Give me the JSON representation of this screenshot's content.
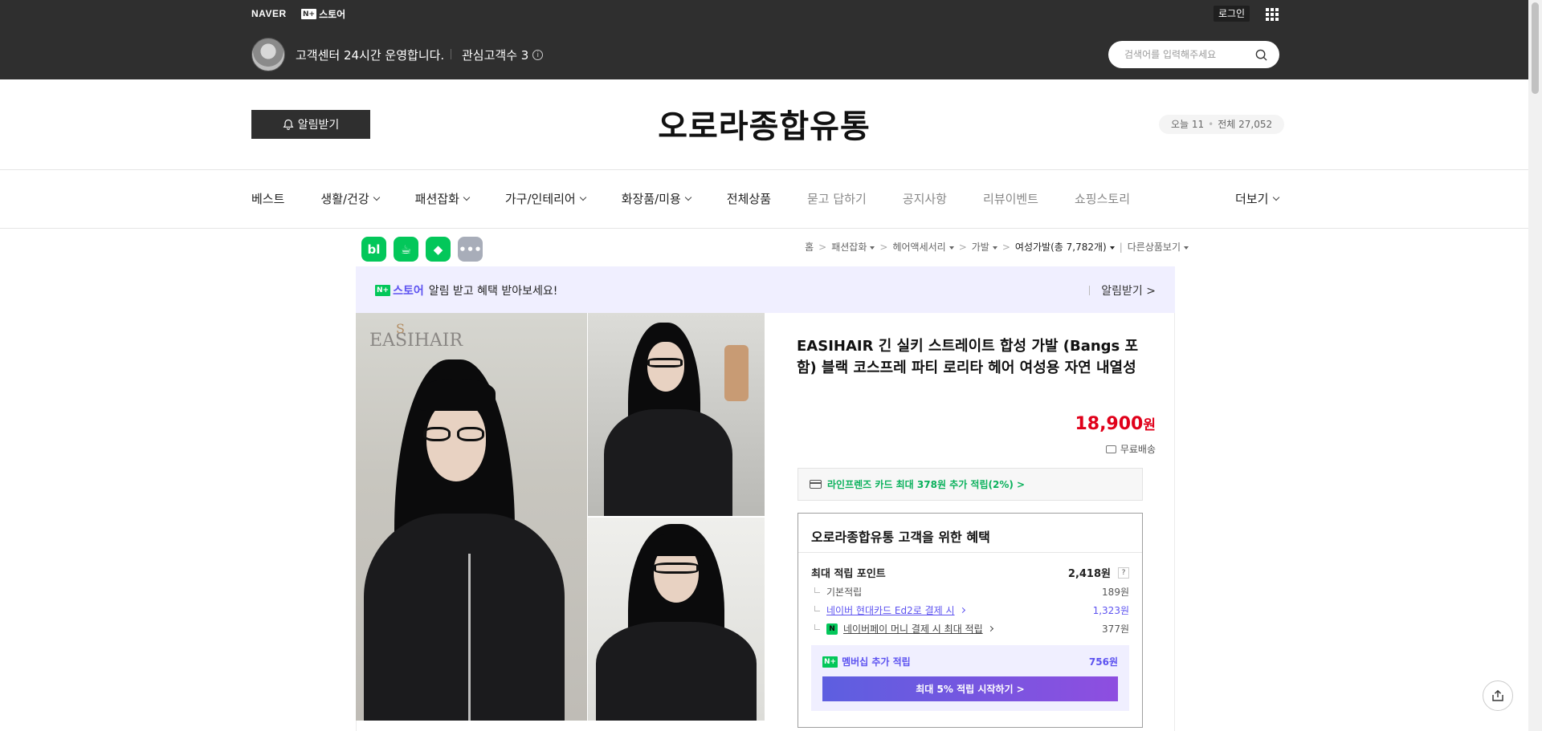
{
  "topbar": {
    "naver_logo": "NAVER",
    "nplus_box": "N+",
    "nplus_text": "스토어",
    "login": "로그인",
    "cs_text": "고객센터 24시간 운영합니다.",
    "fav_text": "관심고객수 3",
    "search_placeholder": "검색어를 입력해주세요"
  },
  "header": {
    "notify_label": "알림받기",
    "store_title": "오로라종합유통",
    "visit_today": "오늘 11",
    "visit_dot": "•",
    "visit_total": "전체 27,052"
  },
  "nav": {
    "items": [
      {
        "label": "베스트",
        "dropdown": false
      },
      {
        "label": "생활/건강",
        "dropdown": true
      },
      {
        "label": "패션잡화",
        "dropdown": true
      },
      {
        "label": "가구/인테리어",
        "dropdown": true
      },
      {
        "label": "화장품/미용",
        "dropdown": true
      },
      {
        "label": "전체상품",
        "dropdown": false
      },
      {
        "label": "묻고 답하기",
        "dropdown": false
      },
      {
        "label": "공지사항",
        "dropdown": false
      },
      {
        "label": "리뷰이벤트",
        "dropdown": false
      },
      {
        "label": "쇼핑스토리",
        "dropdown": false
      }
    ],
    "more": "더보기"
  },
  "social": {
    "blog_icon": "bl",
    "cafe_icon": "☕",
    "bookmark_icon": "◆",
    "more_icon": "•••"
  },
  "breadcrumb": {
    "home": "홈",
    "sep": ">",
    "cat1": "패션잡화",
    "cat2": "헤어액세서리",
    "cat3": "가발",
    "current": "여성가발(총 7,782개)",
    "other": "다른상품보기"
  },
  "promo": {
    "nbox": "N+",
    "store": "스토어",
    "text": "알림 받고 혜택 받아보세요!",
    "action": "알림받기 >"
  },
  "product": {
    "image_brand": "EASIHAIR",
    "title": "EASIHAIR 긴 실키 스트레이트 합성 가발 (Bangs 포함) 블랙 코스프레 파티 로리타 헤어 여성용 자연 내열성",
    "price": "18,900",
    "price_unit": "원",
    "shipping": "무료배송",
    "card_promo": "라인프렌즈 카드 최대 378원 추가 적립(2%) >"
  },
  "benefit": {
    "heading": "오로라종합유통 고객을 위한 혜택",
    "max_points_label": "최대 적립 포인트",
    "max_points_value": "2,418원",
    "qmark": "?",
    "basic_label": "기본적립",
    "basic_value": "189원",
    "card_label": "네이버 현대카드 Ed2로 결제 시",
    "card_value": "1,323원",
    "npay_box": "N",
    "npay_label": "네이버페이 머니 결제 시 최대 적립",
    "npay_value": "377원",
    "member_box": "N+",
    "member_label": "멤버십 추가 적립",
    "member_value": "756원",
    "member_button": "최대 5% 적립 시작하기 >"
  },
  "colors": {
    "header_bg": "#2f2f2f",
    "price_red": "#e0001a",
    "naver_green": "#03c75a",
    "plus_purple": "#5c52f0",
    "promo_bg": "#f0efff"
  }
}
